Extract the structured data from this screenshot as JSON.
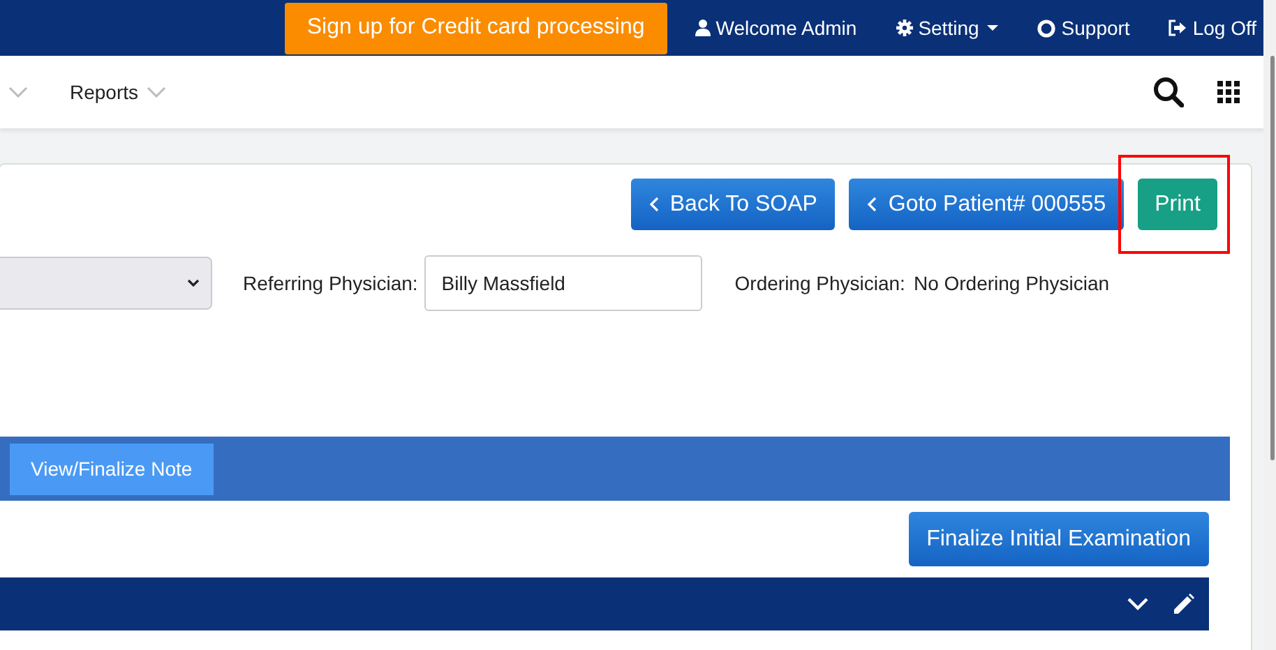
{
  "top_bar": {
    "promo_button": "Sign up for Credit card processing",
    "links": [
      {
        "kind": "user",
        "label": "Welcome Admin"
      },
      {
        "kind": "settings",
        "label": "Setting",
        "dropdown": true
      },
      {
        "kind": "support",
        "label": "Support"
      },
      {
        "kind": "logoff",
        "label": "Log Off"
      }
    ]
  },
  "nav": {
    "items": [
      {
        "label": "Reports"
      }
    ]
  },
  "toolbar": {
    "buttons": [
      {
        "kind": "back",
        "label": "Back To SOAP"
      },
      {
        "kind": "back",
        "label": "Goto Patient# 000555"
      },
      {
        "kind": "print",
        "label": "Print",
        "highlighted": true
      }
    ]
  },
  "form": {
    "referring_label": "Referring Physician:",
    "referring_value": "Billy Massfield",
    "ordering_label": "Ordering Physician:",
    "ordering_value": "No Ordering Physician"
  },
  "note_bar": {
    "button": "View/Finalize Note"
  },
  "finalize_button": "Finalize Initial Examination"
}
